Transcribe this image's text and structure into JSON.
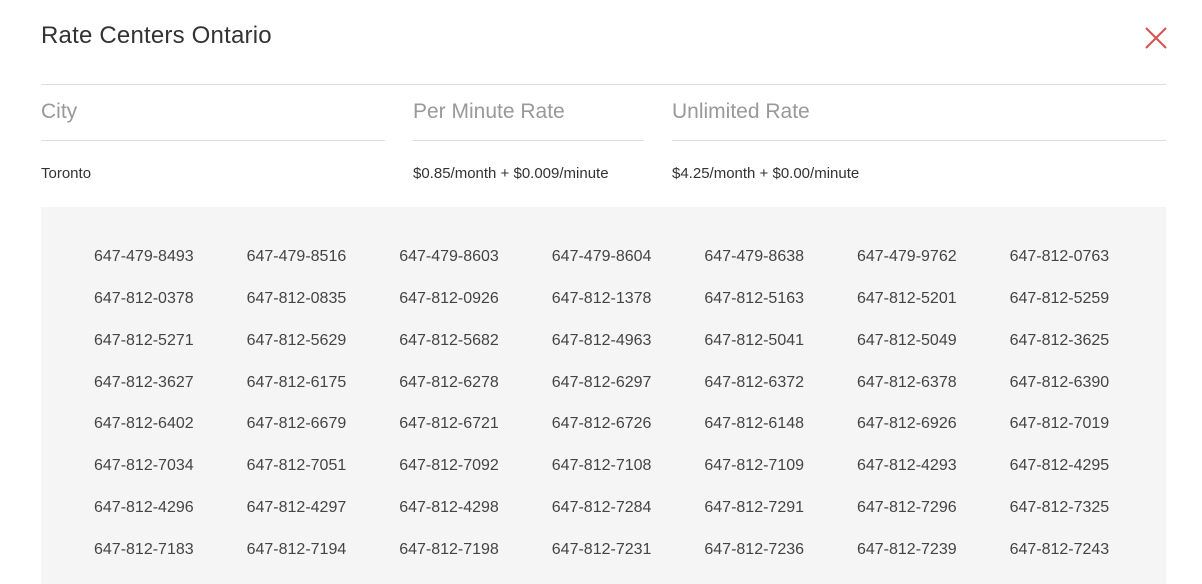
{
  "modal": {
    "title": "Rate Centers Ontario"
  },
  "table": {
    "headers": {
      "city": "City",
      "per_minute": "Per Minute Rate",
      "unlimited": "Unlimited Rate"
    },
    "row": {
      "city": "Toronto",
      "per_minute": "$0.85/month + $0.009/minute",
      "unlimited": "$4.25/month + $0.00/minute"
    }
  },
  "numbers": [
    "647-479-8493",
    "647-479-8516",
    "647-479-8603",
    "647-479-8604",
    "647-479-8638",
    "647-479-9762",
    "647-812-0763",
    "647-812-0378",
    "647-812-0835",
    "647-812-0926",
    "647-812-1378",
    "647-812-5163",
    "647-812-5201",
    "647-812-5259",
    "647-812-5271",
    "647-812-5629",
    "647-812-5682",
    "647-812-4963",
    "647-812-5041",
    "647-812-5049",
    "647-812-3625",
    "647-812-3627",
    "647-812-6175",
    "647-812-6278",
    "647-812-6297",
    "647-812-6372",
    "647-812-6378",
    "647-812-6390",
    "647-812-6402",
    "647-812-6679",
    "647-812-6721",
    "647-812-6726",
    "647-812-6148",
    "647-812-6926",
    "647-812-7019",
    "647-812-7034",
    "647-812-7051",
    "647-812-7092",
    "647-812-7108",
    "647-812-7109",
    "647-812-4293",
    "647-812-4295",
    "647-812-4296",
    "647-812-4297",
    "647-812-4298",
    "647-812-7284",
    "647-812-7291",
    "647-812-7296",
    "647-812-7325",
    "647-812-7183",
    "647-812-7194",
    "647-812-7198",
    "647-812-7231",
    "647-812-7236",
    "647-812-7239",
    "647-812-7243"
  ],
  "colors": {
    "close_icon": "#d9534f",
    "panel_background": "#f5f5f5",
    "header_text": "#999999",
    "divider": "#dddddd"
  },
  "icons": {
    "close": "close-icon"
  }
}
